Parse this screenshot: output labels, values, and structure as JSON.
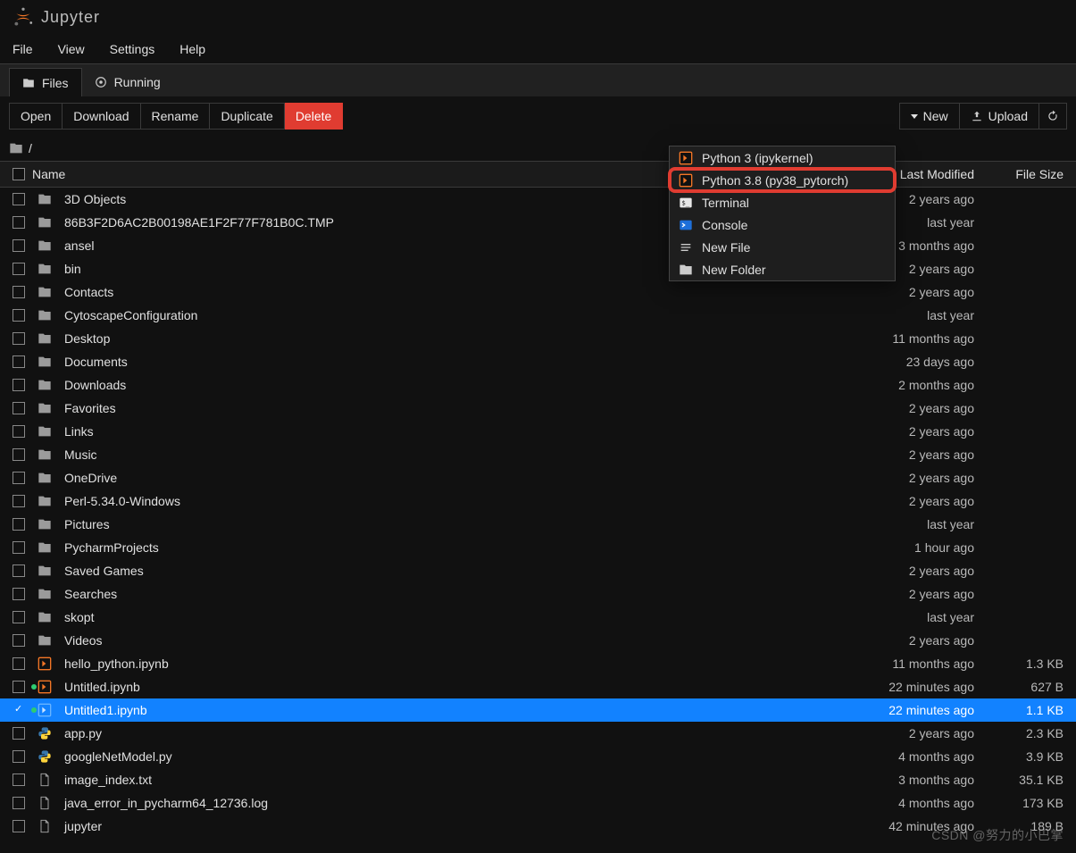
{
  "app": {
    "logo_text": "Jupyter"
  },
  "menu": {
    "items": [
      "File",
      "View",
      "Settings",
      "Help"
    ]
  },
  "tabs": {
    "files": {
      "label": "Files"
    },
    "running": {
      "label": "Running"
    }
  },
  "toolbar": {
    "open": "Open",
    "download": "Download",
    "rename": "Rename",
    "duplicate": "Duplicate",
    "delete": "Delete",
    "new": "New",
    "upload": "Upload"
  },
  "breadcrumb": {
    "path_sep": "/"
  },
  "columns": {
    "name": "Name",
    "modified": "Last Modified",
    "size": "File Size"
  },
  "dropdown": {
    "items": [
      {
        "label": "Python 3 (ipykernel)",
        "icon": "notebook"
      },
      {
        "label": "Python 3.8 (py38_pytorch)",
        "icon": "notebook",
        "highlight": true
      },
      {
        "label": "Terminal",
        "icon": "terminal"
      },
      {
        "label": "Console",
        "icon": "console"
      },
      {
        "label": "New File",
        "icon": "newfile"
      },
      {
        "label": "New Folder",
        "icon": "newfolder"
      }
    ]
  },
  "files": [
    {
      "name": "3D Objects",
      "type": "folder",
      "modified": "2 years ago",
      "size": ""
    },
    {
      "name": "86B3F2D6AC2B00198AE1F2F77F781B0C.TMP",
      "type": "folder",
      "modified": "last year",
      "size": ""
    },
    {
      "name": "ansel",
      "type": "folder",
      "modified": "3 months ago",
      "size": ""
    },
    {
      "name": "bin",
      "type": "folder",
      "modified": "2 years ago",
      "size": ""
    },
    {
      "name": "Contacts",
      "type": "folder",
      "modified": "2 years ago",
      "size": ""
    },
    {
      "name": "CytoscapeConfiguration",
      "type": "folder",
      "modified": "last year",
      "size": ""
    },
    {
      "name": "Desktop",
      "type": "folder",
      "modified": "11 months ago",
      "size": ""
    },
    {
      "name": "Documents",
      "type": "folder",
      "modified": "23 days ago",
      "size": ""
    },
    {
      "name": "Downloads",
      "type": "folder",
      "modified": "2 months ago",
      "size": ""
    },
    {
      "name": "Favorites",
      "type": "folder",
      "modified": "2 years ago",
      "size": ""
    },
    {
      "name": "Links",
      "type": "folder",
      "modified": "2 years ago",
      "size": ""
    },
    {
      "name": "Music",
      "type": "folder",
      "modified": "2 years ago",
      "size": ""
    },
    {
      "name": "OneDrive",
      "type": "folder",
      "modified": "2 years ago",
      "size": ""
    },
    {
      "name": "Perl-5.34.0-Windows",
      "type": "folder",
      "modified": "2 years ago",
      "size": ""
    },
    {
      "name": "Pictures",
      "type": "folder",
      "modified": "last year",
      "size": ""
    },
    {
      "name": "PycharmProjects",
      "type": "folder",
      "modified": "1 hour ago",
      "size": ""
    },
    {
      "name": "Saved Games",
      "type": "folder",
      "modified": "2 years ago",
      "size": ""
    },
    {
      "name": "Searches",
      "type": "folder",
      "modified": "2 years ago",
      "size": ""
    },
    {
      "name": "skopt",
      "type": "folder",
      "modified": "last year",
      "size": ""
    },
    {
      "name": "Videos",
      "type": "folder",
      "modified": "2 years ago",
      "size": ""
    },
    {
      "name": "hello_python.ipynb",
      "type": "notebook",
      "modified": "11 months ago",
      "size": "1.3 KB"
    },
    {
      "name": "Untitled.ipynb",
      "type": "notebook",
      "modified": "22 minutes ago",
      "size": "627 B",
      "running": true
    },
    {
      "name": "Untitled1.ipynb",
      "type": "notebook-selected",
      "modified": "22 minutes ago",
      "size": "1.1 KB",
      "selected": true,
      "running": true
    },
    {
      "name": "app.py",
      "type": "python",
      "modified": "2 years ago",
      "size": "2.3 KB"
    },
    {
      "name": "googleNetModel.py",
      "type": "python",
      "modified": "4 months ago",
      "size": "3.9 KB"
    },
    {
      "name": "image_index.txt",
      "type": "file",
      "modified": "3 months ago",
      "size": "35.1 KB"
    },
    {
      "name": "java_error_in_pycharm64_12736.log",
      "type": "file",
      "modified": "4 months ago",
      "size": "173 KB"
    },
    {
      "name": "jupyter",
      "type": "file",
      "modified": "42 minutes ago",
      "size": "189 B"
    }
  ],
  "watermark": "CSDN @努力的小巴掌"
}
